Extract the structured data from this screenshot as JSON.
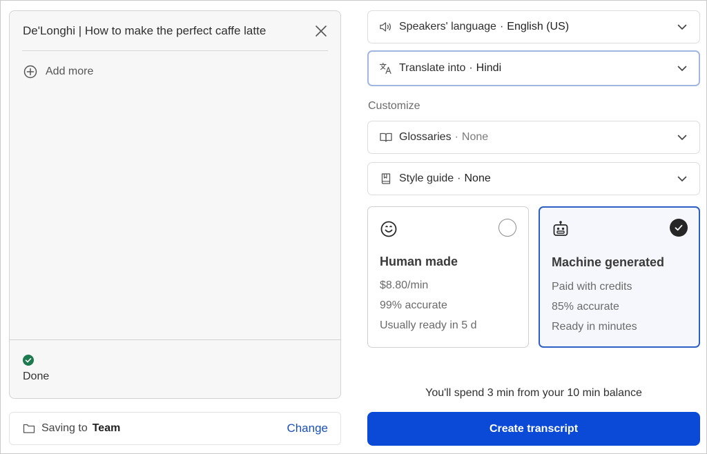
{
  "file": {
    "title": "De'Longhi | How to make the perfect caffe latte",
    "add_more_label": "Add more",
    "status": "Done"
  },
  "saving": {
    "label": "Saving to",
    "value": "Team",
    "change_label": "Change"
  },
  "settings": {
    "speakers_language": {
      "label": "Speakers' language",
      "value": "English (US)"
    },
    "translate_into": {
      "label": "Translate into",
      "value": "Hindi"
    },
    "customize_label": "Customize",
    "glossaries": {
      "label": "Glossaries",
      "value": "None"
    },
    "style_guide": {
      "label": "Style guide",
      "value": "None"
    },
    "separator": "·"
  },
  "options": [
    {
      "title": "Human made",
      "lines": [
        "$8.80/min",
        "99% accurate",
        "Usually ready in 5 d"
      ],
      "selected": false,
      "icon": "smiley-icon"
    },
    {
      "title": "Machine generated",
      "lines": [
        "Paid with credits",
        "85% accurate",
        "Ready in minutes"
      ],
      "selected": true,
      "icon": "robot-icon"
    }
  ],
  "summary": {
    "spend_text": "You'll spend 3 min from your 10 min balance",
    "create_button": "Create transcript"
  },
  "colors": {
    "primary": "#0b4ad6",
    "link": "#1a4fb8",
    "success": "#1c7a4e",
    "selected_border": "#2c5fc4"
  }
}
